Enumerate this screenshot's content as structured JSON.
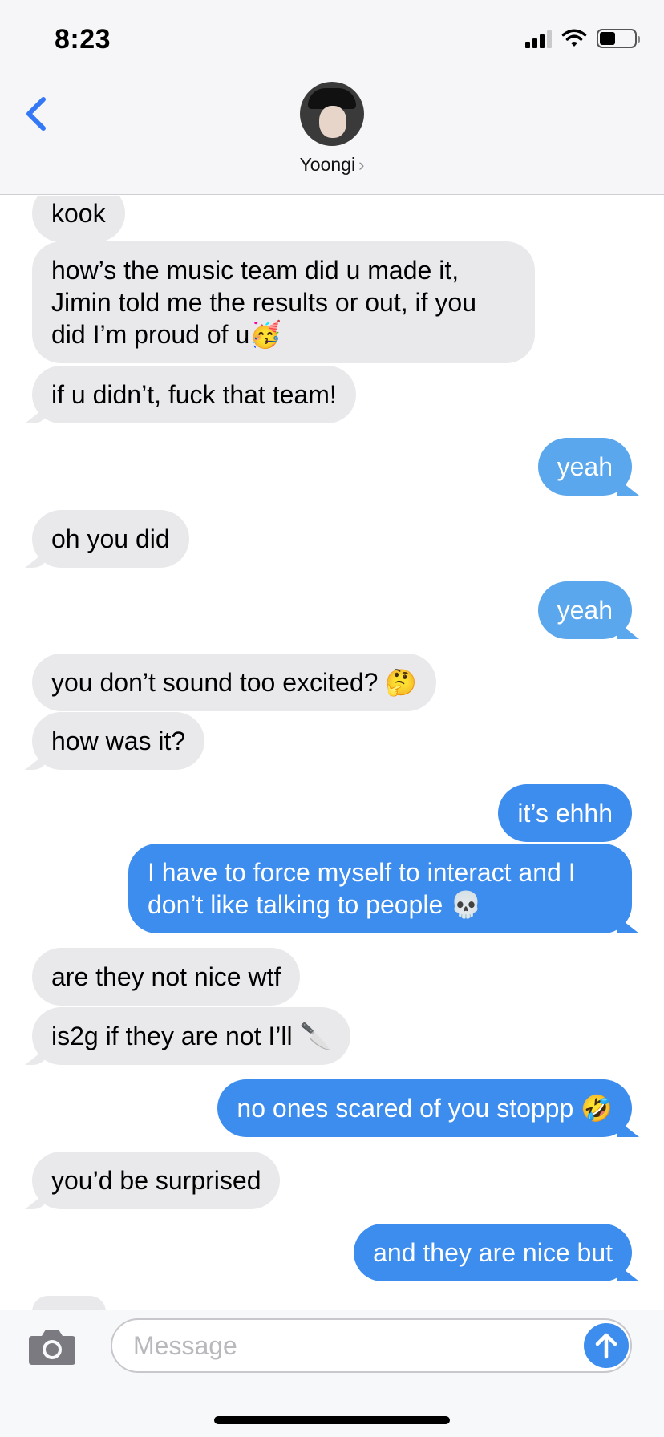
{
  "status_bar": {
    "time": "8:23"
  },
  "header": {
    "contact_name": "Yoongi",
    "chevron": "›"
  },
  "messages": [
    {
      "from": "them",
      "text": "kook"
    },
    {
      "from": "them",
      "text": "how’s the music team did u made it, Jimin told me the results or out, if you did I’m proud of u🥳"
    },
    {
      "from": "them",
      "text": "if u didn’t, fuck that team!"
    },
    {
      "from": "me",
      "text": "yeah"
    },
    {
      "from": "them",
      "text": "oh you did"
    },
    {
      "from": "me",
      "text": "yeah"
    },
    {
      "from": "them",
      "text": "you don’t sound too excited? 🤔"
    },
    {
      "from": "them",
      "text": "how was it?"
    },
    {
      "from": "me",
      "text": "it’s ehhh"
    },
    {
      "from": "me",
      "text": "I have to force myself to interact and I don’t like talking to people 💀"
    },
    {
      "from": "them",
      "text": "are they not nice wtf"
    },
    {
      "from": "them",
      "text": "is2g if they are not I’ll 🔪"
    },
    {
      "from": "me",
      "text": "no ones scared of you stoppp 🤣"
    },
    {
      "from": "them",
      "text": "you’d be surprised"
    },
    {
      "from": "me",
      "text": "and they are nice but"
    }
  ],
  "composer": {
    "placeholder": "Message",
    "value": ""
  },
  "icons": {
    "back": "chevron-left-icon",
    "camera": "camera-icon",
    "send": "arrow-up-icon"
  },
  "colors": {
    "incoming_bubble": "#e9e9ec",
    "outgoing_bubble": "#3d8def",
    "outgoing_bubble_faded": "#5aa7ee",
    "accent": "#3478f6"
  }
}
